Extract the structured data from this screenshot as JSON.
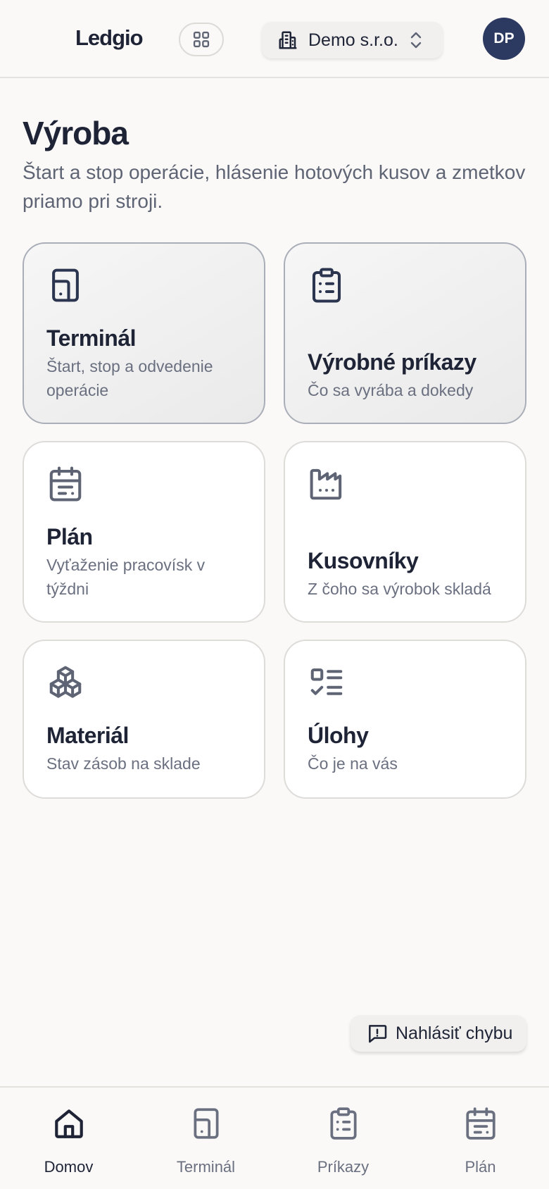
{
  "header": {
    "logo": "Ledgio",
    "org_name": "Demo s.r.o.",
    "avatar_initials": "DP"
  },
  "page": {
    "title": "Výroba",
    "subtitle": "Štart a stop operácie, hlásenie hotových kusov a zmetkov priamo pri stroji."
  },
  "cards": [
    {
      "title": "Terminál",
      "desc": "Štart, stop a odvedenie operácie",
      "icon": "tablet-icon",
      "highlighted": true
    },
    {
      "title": "Výrobné príkazy",
      "desc": "Čo sa vyrába a dokedy",
      "icon": "clipboard-list-icon",
      "highlighted": true
    },
    {
      "title": "Plán",
      "desc": "Vyťaženie pracovísk v týždni",
      "icon": "calendar-icon",
      "highlighted": false
    },
    {
      "title": "Kusovníky",
      "desc": "Z čoho sa výrobok skladá",
      "icon": "factory-icon",
      "highlighted": false
    },
    {
      "title": "Materiál",
      "desc": "Stav zásob na sklade",
      "icon": "boxes-icon",
      "highlighted": false
    },
    {
      "title": "Úlohy",
      "desc": "Čo je na vás",
      "icon": "checklist-icon",
      "highlighted": false
    }
  ],
  "report_bug": {
    "label": "Nahlásiť chybu",
    "icon": "message-alert-icon"
  },
  "bottom_nav": [
    {
      "label": "Domov",
      "icon": "home-icon",
      "active": true
    },
    {
      "label": "Terminál",
      "icon": "tablet-icon",
      "active": false
    },
    {
      "label": "Príkazy",
      "icon": "clipboard-list-icon",
      "active": false
    },
    {
      "label": "Plán",
      "icon": "calendar-icon",
      "active": false
    }
  ],
  "colors": {
    "background": "#faf9f7",
    "text_primary": "#1e2436",
    "text_secondary": "#6b7080",
    "avatar_bg": "#2c3960",
    "icon_color": "#2c3550"
  }
}
